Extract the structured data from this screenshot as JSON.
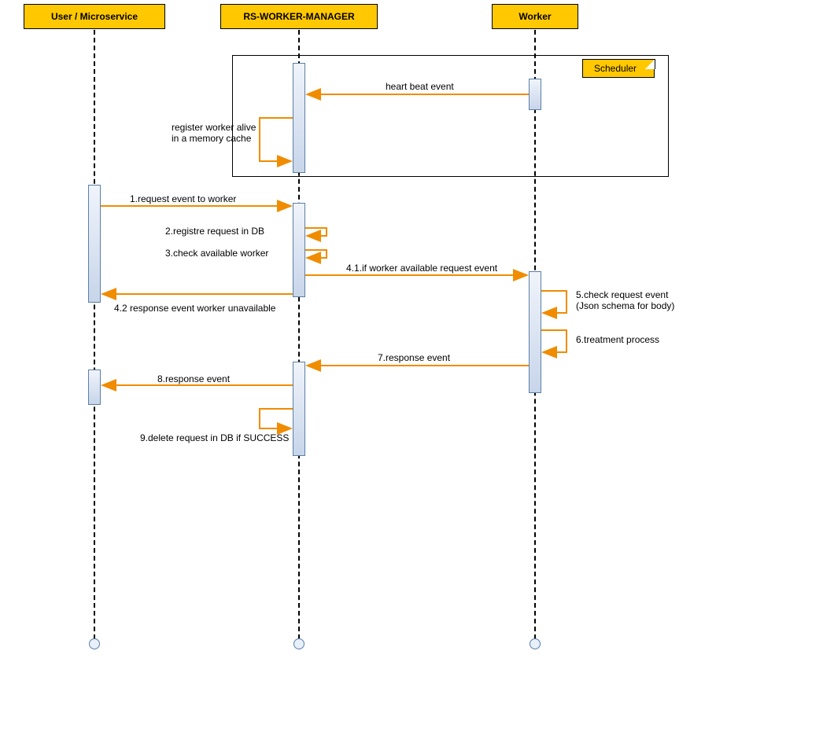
{
  "participants": {
    "user": "User / Microservice",
    "manager": "RS-WORKER-MANAGER",
    "worker": "Worker"
  },
  "frame": {
    "tag": "Scheduler"
  },
  "messages": {
    "heartbeat": "heart beat event",
    "register_cache": "register worker alive\nin a memory cache",
    "m1": "1.request event to worker",
    "m2": "2.registre request in DB",
    "m3": "3.check available worker",
    "m4_1": "4.1.if worker available request event",
    "m4_2": "4.2 response event worker unavailable",
    "m5": "5.check request event\n(Json schema for body)",
    "m6": "6.treatment process",
    "m7": "7.response event",
    "m8": "8.response event",
    "m9": "9.delete request in DB if SUCCESS"
  },
  "colors": {
    "accent": "#f08c00",
    "participant": "#ffc800"
  }
}
